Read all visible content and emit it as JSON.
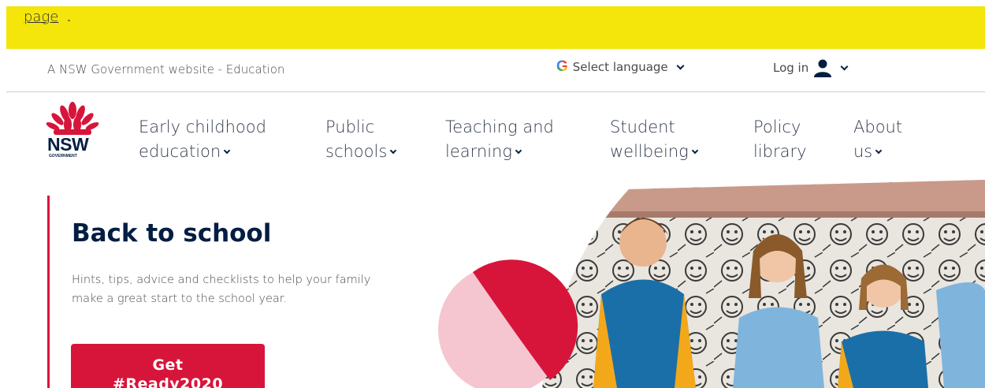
{
  "alert": {
    "link_text": "page",
    "punct": "."
  },
  "utility": {
    "gov_text": "A NSW Government website - Education",
    "language_label": "Select language",
    "login_label": "Log in"
  },
  "logo": {
    "wordmark": "NSW",
    "sub": "GOVERNMENT"
  },
  "nav": {
    "items": [
      {
        "line1": "Early childhood",
        "line2": "education"
      },
      {
        "line1": "Public",
        "line2": "schools"
      },
      {
        "line1": "Teaching and",
        "line2": "learning"
      },
      {
        "line1": "Student",
        "line2": "wellbeing"
      },
      {
        "line1": "Policy",
        "line2": "library"
      },
      {
        "line1": "About",
        "line2": "us"
      }
    ]
  },
  "hero": {
    "title": "Back to school",
    "description": "Hints, tips, advice and checklists to help your family make a great start to the school year.",
    "cta_line1": "Get",
    "cta_line2": "#Ready2020"
  },
  "colors": {
    "alert_bg": "#f4e60b",
    "nsw_red": "#d7153a",
    "nsw_navy": "#041e42",
    "pink": "#f5c6cf"
  },
  "icons": [
    "google-g-icon",
    "chevron-down-icon",
    "user-icon",
    "waratah-logo-icon"
  ]
}
